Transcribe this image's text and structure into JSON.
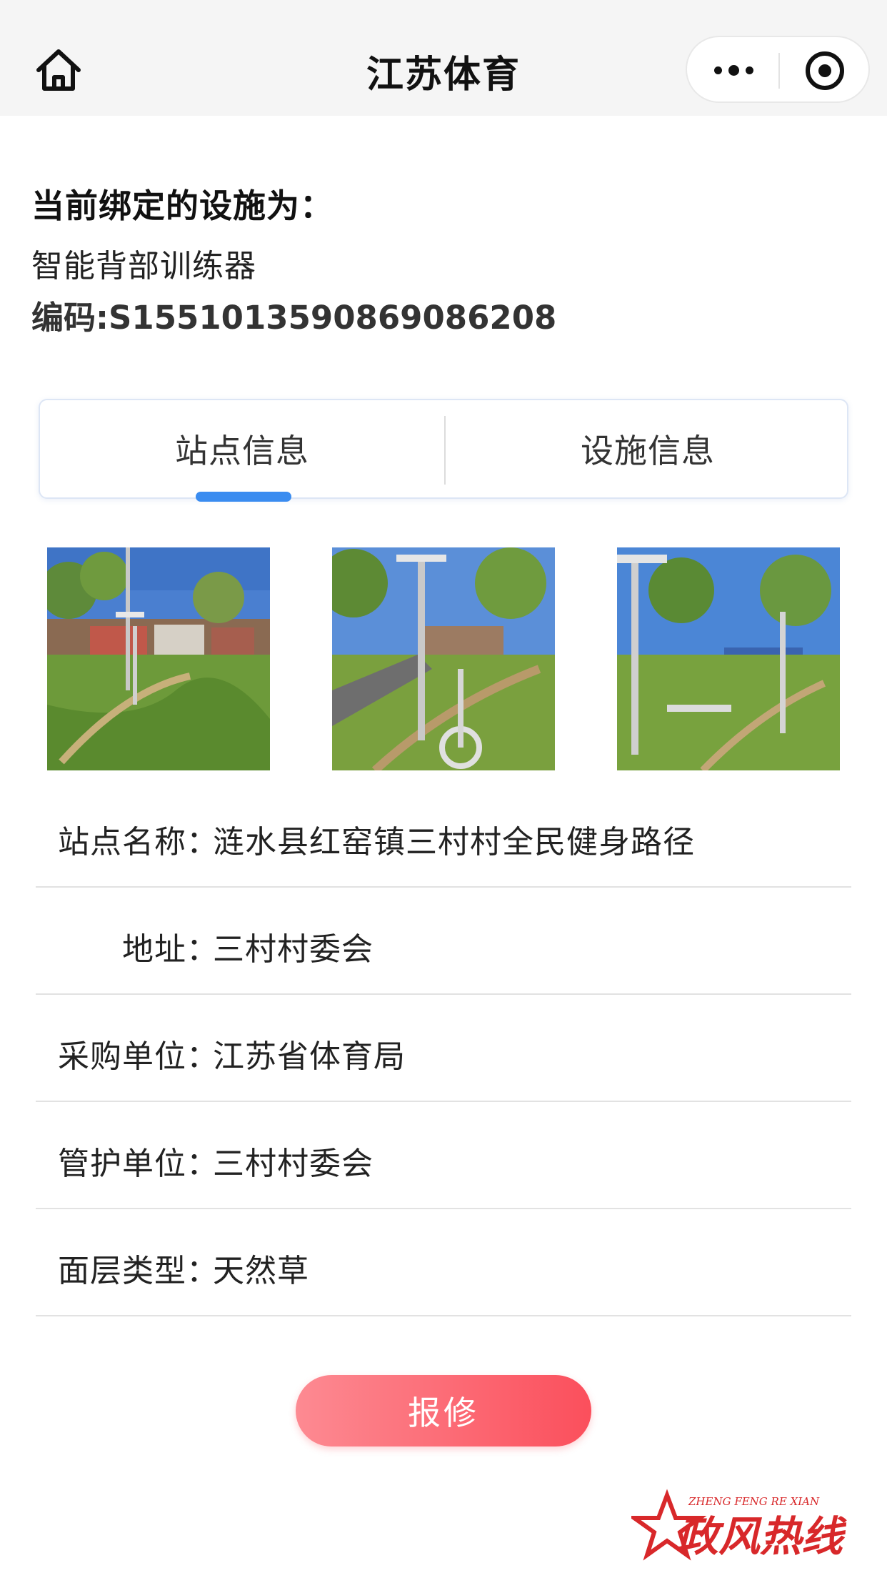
{
  "nav": {
    "title": "江苏体育",
    "home_icon": "home-icon",
    "more_icon": "more-dots-icon",
    "close_icon": "target-circle-icon"
  },
  "binding": {
    "heading": "当前绑定的设施为：",
    "facility_name": "智能背部训练器",
    "code_text": "编码:S1551013590869086208"
  },
  "tabs": [
    {
      "label": "站点信息",
      "active": true
    },
    {
      "label": "设施信息",
      "active": false
    }
  ],
  "photos": [
    {
      "description_icon": "site-photo-1"
    },
    {
      "description_icon": "site-photo-2"
    },
    {
      "description_icon": "site-photo-3"
    }
  ],
  "info": [
    {
      "label": "站点名称：",
      "value": "涟水县红窑镇三村村全民健身路径"
    },
    {
      "label": "地址：",
      "value": "三村村委会"
    },
    {
      "label": "采购单位：",
      "value": "江苏省体育局"
    },
    {
      "label": "管护单位：",
      "value": "三村村委会"
    },
    {
      "label": "面层类型：",
      "value": "天然草"
    }
  ],
  "actions": {
    "repair_label": "报修"
  },
  "watermark": {
    "pinyin": "ZHENG FENG RE XIAN",
    "text": "政风热线"
  },
  "colors": {
    "accent_blue": "#3a8cf0",
    "repair_red": "#fb4f5c",
    "watermark_red": "#d8282a"
  }
}
